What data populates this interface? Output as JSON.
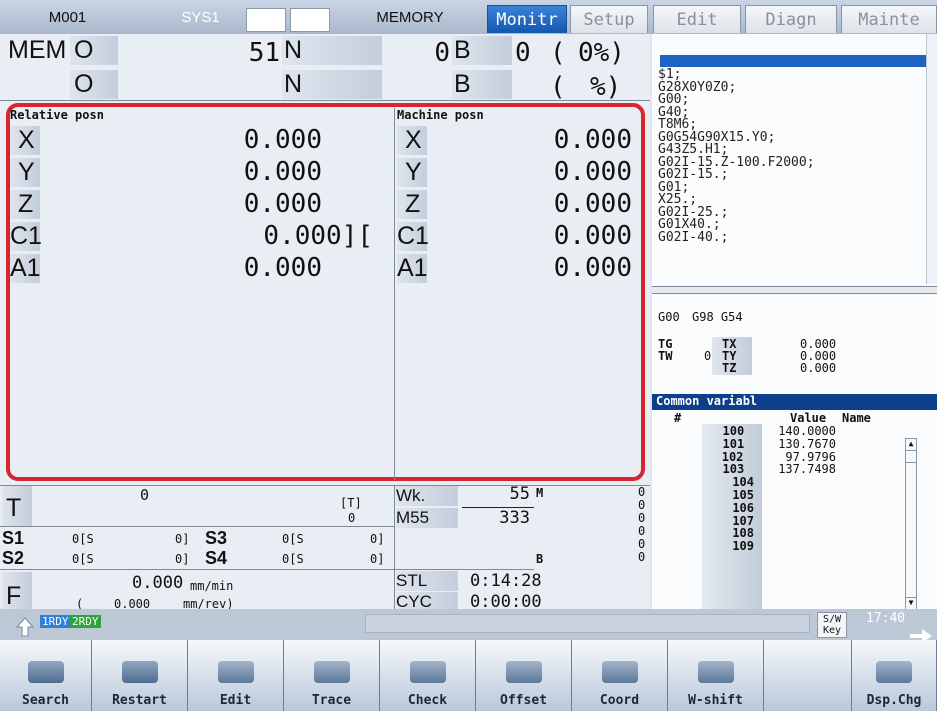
{
  "topbar": {
    "program": "M001",
    "sys": "SYS1",
    "mode": "MEMORY",
    "tabs": [
      "Monitr",
      "Setup",
      "Edit",
      "Diagn",
      "Mainte"
    ]
  },
  "status": {
    "row1": {
      "mode": "MEM",
      "o_label": "O",
      "o_val": "51",
      "n_label": "N",
      "n_val": "0",
      "b_label": "B",
      "b_val": "0",
      "paren": "(",
      "pct": "0%)"
    },
    "row2": {
      "o_label": "O",
      "n_label": "N",
      "b_label": "B",
      "paren": "(",
      "pct": "%)"
    }
  },
  "relative": {
    "title": "Relative posn",
    "rows": [
      {
        "axis": "X",
        "value": "0.000"
      },
      {
        "axis": "Y",
        "value": "0.000"
      },
      {
        "axis": "Z",
        "value": "0.000"
      },
      {
        "axis": "C1",
        "value": "0.000]["
      },
      {
        "axis": "A1",
        "value": "0.000"
      }
    ]
  },
  "machine": {
    "title": "Machine posn",
    "rows": [
      {
        "axis": "X",
        "value": "0.000"
      },
      {
        "axis": "Y",
        "value": "0.000"
      },
      {
        "axis": "Z",
        "value": "0.000"
      },
      {
        "axis": "C1",
        "value": "0.000"
      },
      {
        "axis": "A1",
        "value": "0.000"
      }
    ]
  },
  "program_lines": [
    "$1;",
    "G28X0Y0Z0;",
    "G00;",
    "G40;",
    "T8M6;",
    "G0G54G90X15.Y0;",
    "G43Z5.H1;",
    "G02I-15.Z-100.F2000;",
    "G02I-15.;",
    "G01;",
    "X25.;",
    "G02I-25.;",
    "G01X40.;",
    "G02I-40.;"
  ],
  "modal": {
    "codes": [
      "G00",
      "G98 G54"
    ],
    "tg": "TG",
    "tw": "TW",
    "tw_val": "0",
    "tx": "TX",
    "ty": "TY",
    "tz": "TZ",
    "tx_val": "0.000",
    "ty_val": "0.000",
    "tz_val": "0.000"
  },
  "common": {
    "title": "Common variabl",
    "col_num": "#",
    "col_val": "Value",
    "col_name": "Name",
    "rows": [
      {
        "n": "100",
        "v": "140.0000"
      },
      {
        "n": "101",
        "v": "130.7670"
      },
      {
        "n": "102",
        "v": "97.9796"
      },
      {
        "n": "103",
        "v": "137.7498"
      },
      {
        "n": "104",
        "v": ""
      },
      {
        "n": "105",
        "v": ""
      },
      {
        "n": "106",
        "v": ""
      },
      {
        "n": "107",
        "v": ""
      },
      {
        "n": "108",
        "v": ""
      },
      {
        "n": "109",
        "v": ""
      }
    ]
  },
  "tool": {
    "t_label": "T",
    "t_val": "0",
    "t_br": "[T]",
    "t_br_val": "0",
    "s1": "S1",
    "s1v": "0[S",
    "s1b": "0]",
    "s3": "S3",
    "s3v": "0[S",
    "s3b": "0]",
    "s2": "S2",
    "s2v": "0[S",
    "s2b": "0]",
    "s4": "S4",
    "s4v": "0[S",
    "s4b": "0]",
    "f": "F",
    "f_val": "0.000",
    "f_unit": "mm/min",
    "f_paren": "(",
    "f_val2": "0.000",
    "f_unit2": "mm/rev)"
  },
  "work": {
    "wk": "Wk.",
    "wk_val": "55",
    "m55": "M55",
    "m55_val": "333",
    "m": "M",
    "b": "B",
    "zeros": [
      "0",
      "0",
      "0",
      "0",
      "0",
      "0"
    ],
    "stl": "STL",
    "stl_val": "0:14:28",
    "cyc": "CYC",
    "cyc_val": "0:00:00"
  },
  "bottombar": {
    "rdy1": "1RDY",
    "rdy2": "2RDY",
    "sw": "S/W",
    "key": "Key",
    "time": "17:40"
  },
  "softkeys": [
    "Search",
    "Restart",
    "Edit",
    "Trace",
    "Check",
    "Offset",
    "Coord",
    "W-shift",
    "",
    "Dsp.Chg"
  ],
  "colors": {
    "highlight_border": "#d7262f",
    "active_tab": "#1a60bf"
  }
}
